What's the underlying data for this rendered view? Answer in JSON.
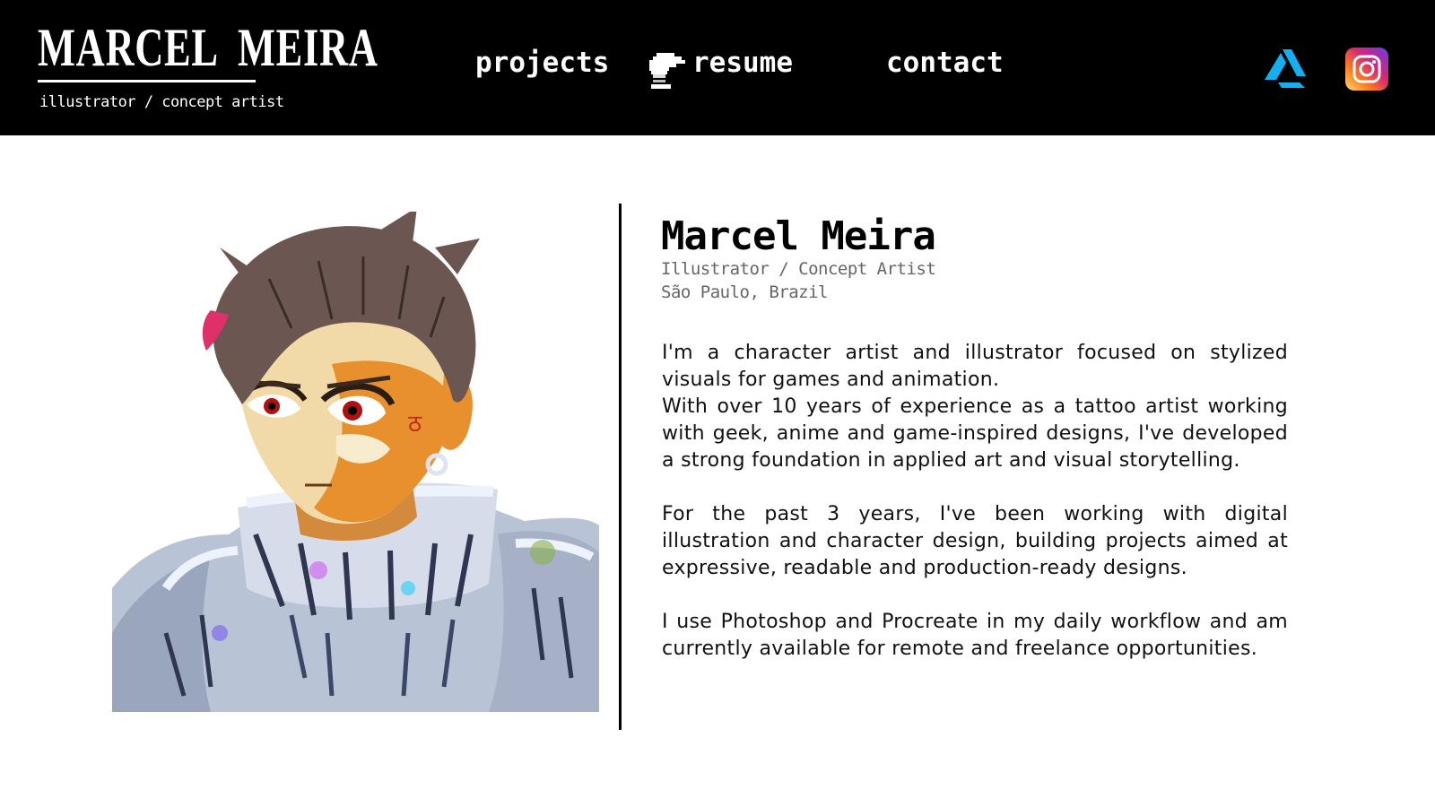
{
  "header": {
    "logo_title": "MARCEL MEIRA",
    "logo_subtitle": "illustrator / concept artist",
    "nav": {
      "projects": "projects",
      "resume": "resume",
      "contact": "contact"
    },
    "social": {
      "artstation_icon": "artstation-icon",
      "instagram_icon": "instagram-icon"
    }
  },
  "profile": {
    "name": "Marcel Meira",
    "role": "Illustrator / Concept Artist",
    "location": "São Paulo, Brazil",
    "bio": {
      "p1_a": "I'm a character artist and illustrator focused on stylized visuals for games and animation.",
      "p1_b": "With over 10 years of experience as a tattoo artist working with geek, anime and game-inspired designs, I've developed a strong foundation in applied art and visual storytelling.",
      "p2": "For the past 3 years, I've been working with digital illustration and character design, building projects aimed at expressive, readable and production-ready designs.",
      "p3": "I use Photoshop and Procreate in my daily workflow and am currently available for remote and freelance opportunities."
    }
  },
  "colors": {
    "header_bg": "#000000",
    "artstation_blue": "#13AFF0",
    "instagram_gradient": [
      "#FEDA75",
      "#FA7E1E",
      "#D62976",
      "#962FBF",
      "#4F5BD5"
    ]
  }
}
